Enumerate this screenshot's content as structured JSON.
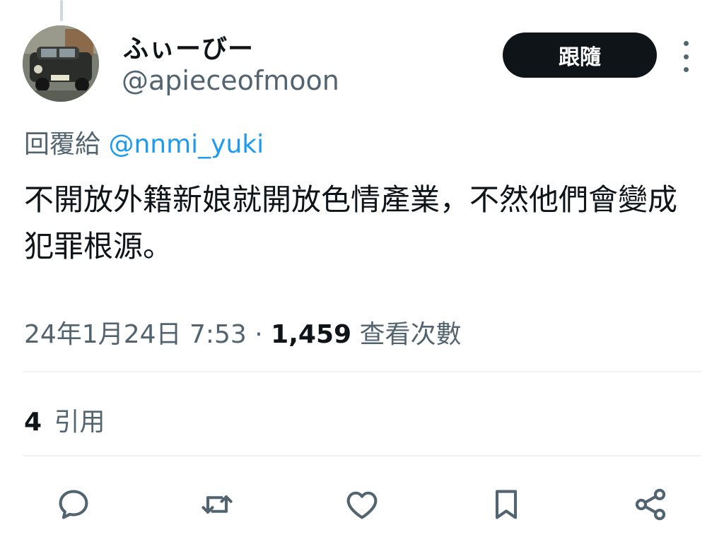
{
  "author": {
    "display_name": "ふぃーびー",
    "handle": "@apieceofmoon",
    "avatar_alt": "avatar-vintage-car"
  },
  "follow_button": {
    "label": "跟隨"
  },
  "reply_to": {
    "prefix": "回覆給",
    "mention": "@nnmi_yuki"
  },
  "tweet": {
    "text": "不開放外籍新娘就開放色情產業，不然他們會變成犯罪根源。",
    "date": "24年1月24日 7:53",
    "separator": "·",
    "views_count": "1,459",
    "views_label": "查看次數"
  },
  "stats": {
    "quotes_count": "4",
    "quotes_label": "引用"
  },
  "actions": [
    {
      "name": "reply",
      "icon": "reply-icon"
    },
    {
      "name": "retweet",
      "icon": "retweet-icon"
    },
    {
      "name": "like",
      "icon": "heart-icon"
    },
    {
      "name": "bookmark",
      "icon": "bookmark-icon"
    },
    {
      "name": "share",
      "icon": "share-icon"
    }
  ],
  "colors": {
    "text_primary": "#0f1419",
    "text_secondary": "#536471",
    "accent": "#1d9bf0",
    "divider": "#eff3f4"
  }
}
